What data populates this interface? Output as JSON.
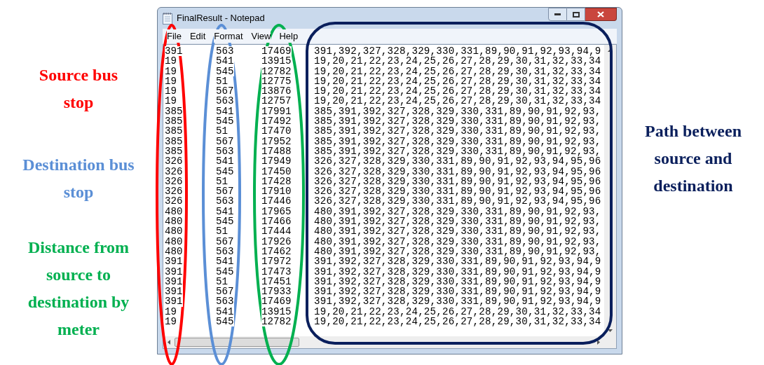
{
  "window": {
    "title": "FinalResult - Notepad"
  },
  "menu": [
    "File",
    "Edit",
    "Format",
    "View",
    "Help"
  ],
  "lines": [
    [
      "391",
      "563",
      "17469",
      "391,392,327,328,329,330,331,89,90,91,92,93,94,9"
    ],
    [
      "19",
      "541",
      "13915",
      "19,20,21,22,23,24,25,26,27,28,29,30,31,32,33,34"
    ],
    [
      "19",
      "545",
      "12782",
      "19,20,21,22,23,24,25,26,27,28,29,30,31,32,33,34"
    ],
    [
      "19",
      "51",
      "12775",
      "19,20,21,22,23,24,25,26,27,28,29,30,31,32,33,34"
    ],
    [
      "19",
      "567",
      "13876",
      "19,20,21,22,23,24,25,26,27,28,29,30,31,32,33,34"
    ],
    [
      "19",
      "563",
      "12757",
      "19,20,21,22,23,24,25,26,27,28,29,30,31,32,33,34"
    ],
    [
      "385",
      "541",
      "17991",
      "385,391,392,327,328,329,330,331,89,90,91,92,93,"
    ],
    [
      "385",
      "545",
      "17492",
      "385,391,392,327,328,329,330,331,89,90,91,92,93,"
    ],
    [
      "385",
      "51",
      "17470",
      "385,391,392,327,328,329,330,331,89,90,91,92,93,"
    ],
    [
      "385",
      "567",
      "17952",
      "385,391,392,327,328,329,330,331,89,90,91,92,93,"
    ],
    [
      "385",
      "563",
      "17488",
      "385,391,392,327,328,329,330,331,89,90,91,92,93,"
    ],
    [
      "326",
      "541",
      "17949",
      "326,327,328,329,330,331,89,90,91,92,93,94,95,96"
    ],
    [
      "326",
      "545",
      "17450",
      "326,327,328,329,330,331,89,90,91,92,93,94,95,96"
    ],
    [
      "326",
      "51",
      "17428",
      "326,327,328,329,330,331,89,90,91,92,93,94,95,96"
    ],
    [
      "326",
      "567",
      "17910",
      "326,327,328,329,330,331,89,90,91,92,93,94,95,96"
    ],
    [
      "326",
      "563",
      "17446",
      "326,327,328,329,330,331,89,90,91,92,93,94,95,96"
    ],
    [
      "480",
      "541",
      "17965",
      "480,391,392,327,328,329,330,331,89,90,91,92,93,"
    ],
    [
      "480",
      "545",
      "17466",
      "480,391,392,327,328,329,330,331,89,90,91,92,93,"
    ],
    [
      "480",
      "51",
      "17444",
      "480,391,392,327,328,329,330,331,89,90,91,92,93,"
    ],
    [
      "480",
      "567",
      "17926",
      "480,391,392,327,328,329,330,331,89,90,91,92,93,"
    ],
    [
      "480",
      "563",
      "17462",
      "480,391,392,327,328,329,330,331,89,90,91,92,93,"
    ],
    [
      "391",
      "541",
      "17972",
      "391,392,327,328,329,330,331,89,90,91,92,93,94,9"
    ],
    [
      "391",
      "545",
      "17473",
      "391,392,327,328,329,330,331,89,90,91,92,93,94,9"
    ],
    [
      "391",
      "51",
      "17451",
      "391,392,327,328,329,330,331,89,90,91,92,93,94,9"
    ],
    [
      "391",
      "567",
      "17933",
      "391,392,327,328,329,330,331,89,90,91,92,93,94,9"
    ],
    [
      "391",
      "563",
      "17469",
      "391,392,327,328,329,330,331,89,90,91,92,93,94,9"
    ],
    [
      "19",
      "541",
      "13915",
      "19,20,21,22,23,24,25,26,27,28,29,30,31,32,33,34"
    ],
    [
      "19",
      "545",
      "12782",
      "19,20,21,22,23,24,25,26,27,28,29,30,31,32,33,34"
    ]
  ],
  "annotations": [
    {
      "text": "Source bus stop",
      "color": "#ff0000"
    },
    {
      "text": "Destination bus stop",
      "color": "#5b8fd6"
    },
    {
      "text": "Distance from source to destination by meter",
      "color": "#00b050"
    },
    {
      "text": "Path between source and destination",
      "color": "#0a1f5c"
    }
  ]
}
